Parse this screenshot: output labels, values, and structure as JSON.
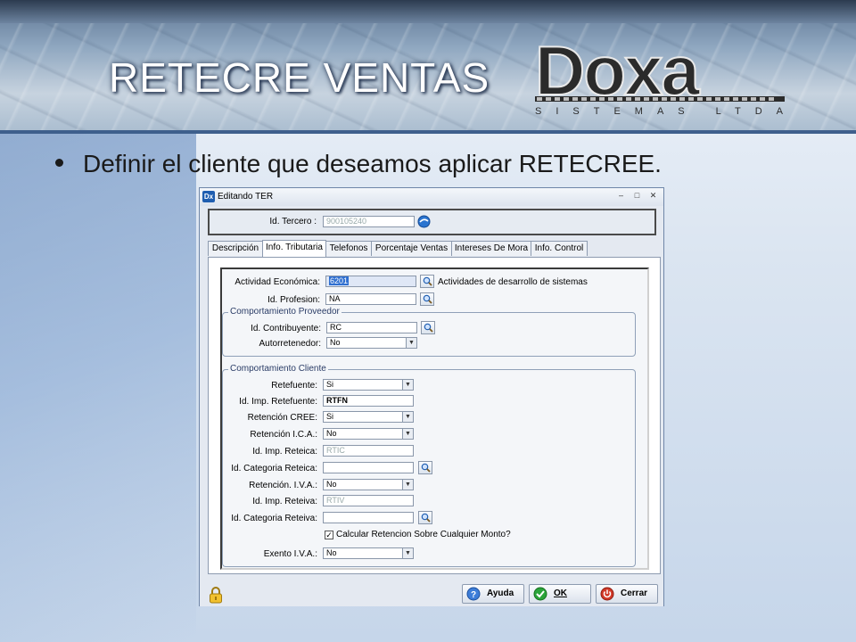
{
  "slide": {
    "title": "RETECRE VENTAS",
    "bullet": "Definir el cliente que deseamos aplicar RETECREE.",
    "logo": {
      "brand": "Doxa",
      "subtitle": "SISTEMAS LTDA."
    }
  },
  "window": {
    "title": "Editando TER",
    "controls": {
      "minimize": "–",
      "maximize": "□",
      "close": "✕"
    },
    "id_tercero": {
      "label": "Id. Tercero :",
      "value": "900105240"
    },
    "tabs": [
      {
        "label": "Descripción"
      },
      {
        "label": "Info. Tributaria",
        "active": true
      },
      {
        "label": "Telefonos"
      },
      {
        "label": "Porcentaje Ventas"
      },
      {
        "label": "Intereses De Mora"
      },
      {
        "label": "Info. Control"
      }
    ],
    "general": {
      "actividad": {
        "label": "Actividad Económica:",
        "value": "6201",
        "description": "Actividades de desarrollo de sistemas"
      },
      "profesion": {
        "label": "Id. Profesion:",
        "value": "NA"
      }
    },
    "proveedor": {
      "title": "Comportamiento Proveedor",
      "contribuyente": {
        "label": "Id. Contribuyente:",
        "value": "RC"
      },
      "autorretenedor": {
        "label": "Autorretenedor:",
        "value": "No"
      }
    },
    "cliente": {
      "title": "Comportamiento Cliente",
      "retefuente": {
        "label": "Retefuente:",
        "value": "Si"
      },
      "imp_retefuente": {
        "label": "Id. Imp. Retefuente:",
        "value": "RTFN"
      },
      "retencion_cree": {
        "label": "Retención CREE:",
        "value": "Si"
      },
      "retencion_ica": {
        "label": "Retención I.C.A.:",
        "value": "No"
      },
      "imp_reteica": {
        "label": "Id. Imp. Reteica:",
        "value": "RTIC"
      },
      "categoria_reteica": {
        "label": "Id. Categoria Reteica:",
        "value": ""
      },
      "retencion_iva": {
        "label": "Retención. I.V.A.:",
        "value": "No"
      },
      "imp_reteiva": {
        "label": "Id. Imp. Reteiva:",
        "value": "RTIV"
      },
      "categoria_reteiva": {
        "label": "Id. Categoria Reteiva:",
        "value": ""
      },
      "calcular": {
        "label": "Calcular Retencion Sobre Cualquier Monto?",
        "checked": true
      }
    },
    "exento_iva": {
      "label": "Exento I.V.A.:",
      "value": "No"
    },
    "buttons": {
      "help": "Ayuda",
      "ok": "OK",
      "close": "Cerrar"
    }
  },
  "colors": {
    "accent": "#1f5eb0",
    "title_shadow": "#2a3a55",
    "ok_green": "#2aa43a",
    "close_red": "#d23a2a"
  }
}
